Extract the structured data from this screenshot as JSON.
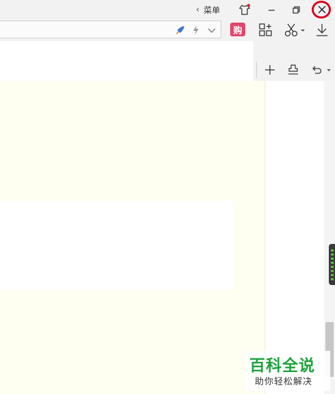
{
  "titlebar": {
    "menu_label": "菜单",
    "icons": [
      "chevron-left-icon",
      "skin-icon",
      "minimize-icon",
      "restore-icon",
      "close-icon"
    ]
  },
  "toolbar": {
    "buy_label": "购",
    "address_icons": [
      "rocket-icon",
      "lightning-icon",
      "chevron-down-icon"
    ],
    "tools": [
      "apps-add-icon",
      "scissors-icon",
      "download-icon"
    ]
  },
  "editor_toolbar": {
    "icons": [
      "plus-icon",
      "stamp-icon",
      "undo-icon"
    ]
  },
  "watermark": {
    "title": "百科全说",
    "subtitle": "助你轻松解决"
  },
  "colors": {
    "accent_red": "#d6001c",
    "buy_badge": "#e2456b",
    "watermark_green": "#1ea33c",
    "doc_background": "#fefef1"
  }
}
